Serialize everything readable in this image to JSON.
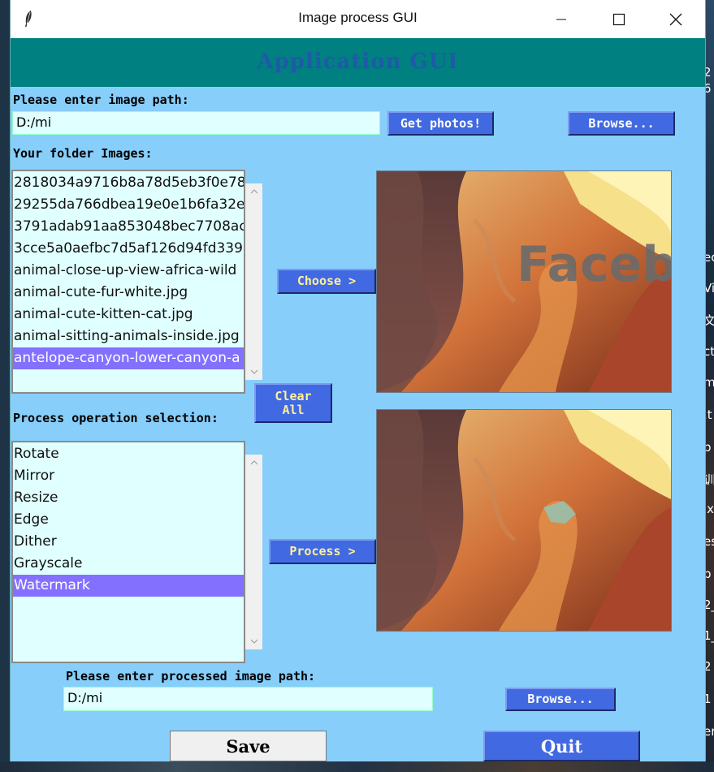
{
  "window": {
    "title": "Image process GUI",
    "banner": "Application GUI"
  },
  "input_section": {
    "label": "Please enter image path:",
    "path_value": "D:/mi",
    "get_photos_label": "Get photos!",
    "browse_label": "Browse..."
  },
  "folder_section": {
    "label": "Your folder Images:",
    "files": [
      "2818034a9716b8a78d5eb3f0e78",
      "29255da766dbea19e0e1b6fa32e",
      "3791adab91aa853048bec7708ac",
      "3cce5a0aefbc7d5af126d94fd339",
      "animal-close-up-view-africa-wild",
      "animal-cute-fur-white.jpg",
      "animal-cute-kitten-cat.jpg",
      "animal-sitting-animals-inside.jpg",
      "antelope-canyon-lower-canyon-a"
    ],
    "selected_index": 8,
    "choose_label": "Choose >",
    "clear_all_label": "Clear\nAll"
  },
  "process_section": {
    "label": "Process operation selection:",
    "operations": [
      "Rotate",
      "Mirror",
      "Resize",
      "Edge",
      "Dither",
      "Grayscale",
      "Watermark"
    ],
    "selected_index": 6,
    "process_label": "Process >"
  },
  "preview": {
    "original_watermark_text": "Faceboo"
  },
  "output_section": {
    "label": "Please enter processed image path:",
    "path_value": "D:/mi",
    "browse_label": "Browse..."
  },
  "footer": {
    "save_label": "Save",
    "quit_label": "Quit"
  },
  "desktop_fragments": [
    "2",
    "6",
    "ec",
    "Vi",
    "文",
    "ct",
    "m",
    ".t",
    "p",
    "训",
    "ix",
    "es",
    "p",
    "2_",
    "1_",
    "2",
    "1",
    "er",
    "jinnac"
  ],
  "colors": {
    "window_bg": "#87cefa",
    "banner_bg": "#008080",
    "banner_text": "#1f5aa8",
    "button_bg": "#4169e1",
    "entry_bg": "#e0ffff",
    "selection": "#8470ff"
  }
}
